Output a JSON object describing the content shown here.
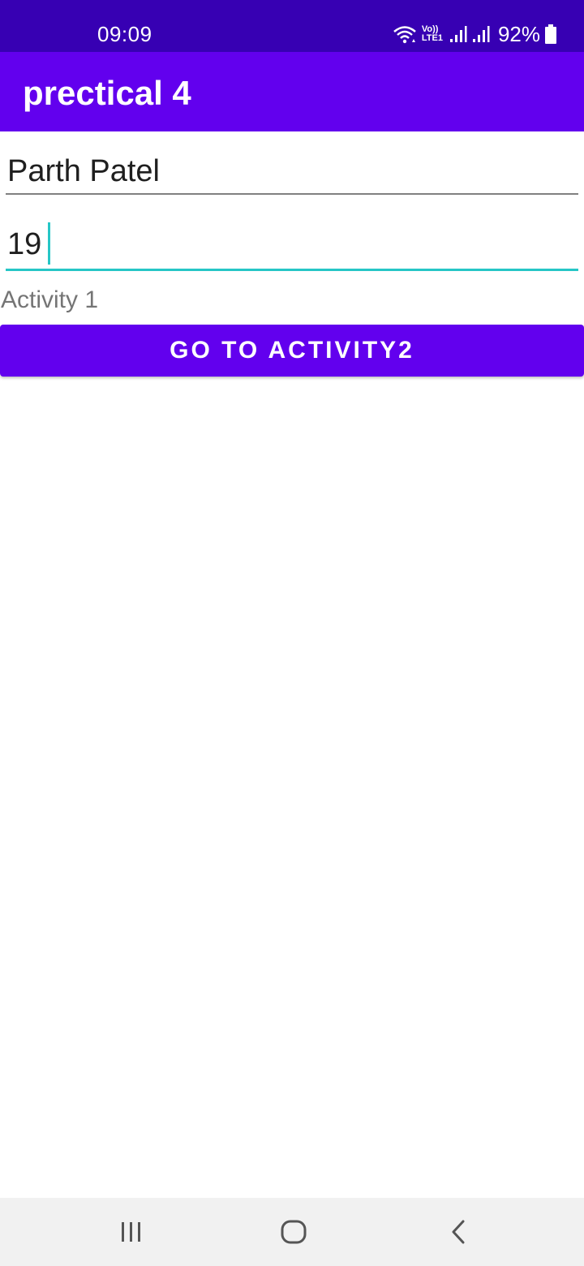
{
  "status_bar": {
    "time": "09:09",
    "volte_top": "Vo))",
    "volte_bottom": "LTE1",
    "battery": "92%",
    "icons": [
      "wifi-icon",
      "signal-icon",
      "signal-icon",
      "battery-icon"
    ],
    "color": "#3700b3"
  },
  "app_bar": {
    "title": "prectical 4",
    "color": "#6200ee"
  },
  "form": {
    "name_value": "Parth Patel",
    "age_value": "19",
    "accent_color": "#26c6c6"
  },
  "activity_label": "Activity 1",
  "go_button": {
    "label": "GO TO ACTIVITY2"
  },
  "nav_bar": {
    "icons": [
      "recents-icon",
      "home-icon",
      "back-icon"
    ]
  }
}
